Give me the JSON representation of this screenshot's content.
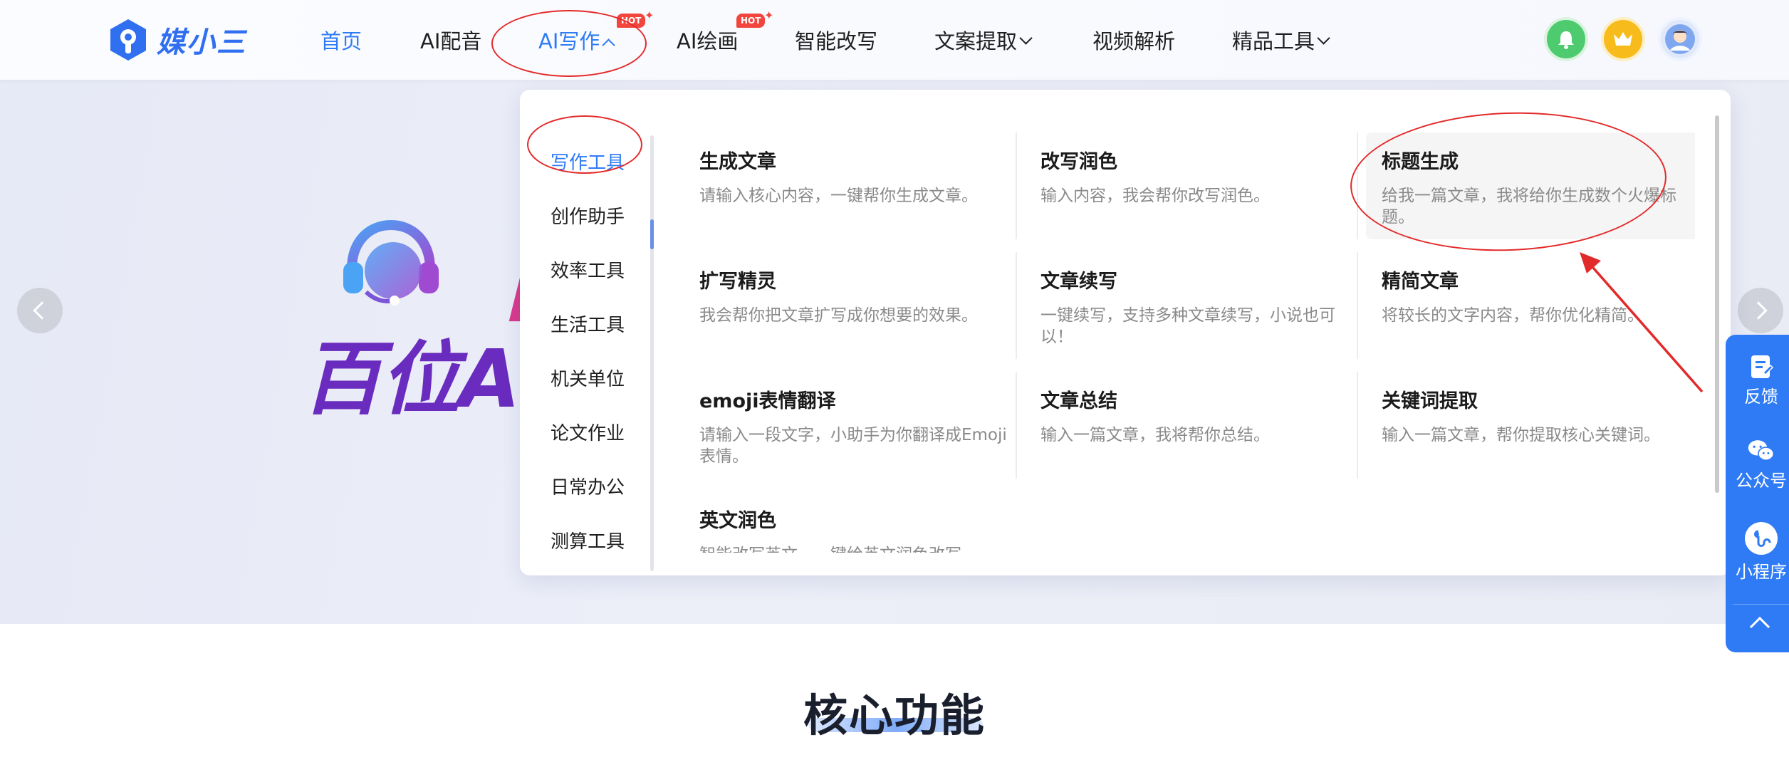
{
  "header": {
    "logo_text": "媒小三",
    "nav": [
      {
        "label": "首页",
        "active": true
      },
      {
        "label": "AI配音"
      },
      {
        "label": "AI写作",
        "open": true,
        "hot": true
      },
      {
        "label": "AI绘画",
        "hot": true
      },
      {
        "label": "智能改写"
      },
      {
        "label": "文案提取",
        "dropdown": true
      },
      {
        "label": "视频解析"
      },
      {
        "label": "精品工具",
        "dropdown": true
      }
    ],
    "hot_badge": "HOT",
    "icons": [
      "bell-icon",
      "crown-icon",
      "user-avatar"
    ]
  },
  "banner": {
    "bracket": "【",
    "text": "百位AI",
    "slides": 3,
    "active_slide": 2
  },
  "dropdown": {
    "categories": [
      "写作工具",
      "创作助手",
      "效率工具",
      "生活工具",
      "机关单位",
      "论文作业",
      "日常办公",
      "测算工具"
    ],
    "active_category": 0,
    "tools": [
      {
        "title": "生成文章",
        "desc": "请输入核心内容，一键帮你生成文章。"
      },
      {
        "title": "改写润色",
        "desc": "输入内容，我会帮你改写润色。"
      },
      {
        "title": "标题生成",
        "desc": "给我一篇文章，我将给你生成数个火爆标题。"
      },
      {
        "title": "扩写精灵",
        "desc": "我会帮你把文章扩写成你想要的效果。"
      },
      {
        "title": "文章续写",
        "desc": "一键续写，支持多种文章续写，小说也可以！"
      },
      {
        "title": "精简文章",
        "desc": "将较长的文字内容，帮你优化精简。"
      },
      {
        "title": "emoji表情翻译",
        "desc": "请输入一段文字，小助手为你翻译成Emoji表情。"
      },
      {
        "title": "文章总结",
        "desc": "输入一篇文章，我将帮你总结。"
      },
      {
        "title": "关键词提取",
        "desc": "输入一篇文章，帮你提取核心关键词。"
      },
      {
        "title": "英文润色",
        "desc": "智能改写英文，一键给英文润色改写"
      }
    ]
  },
  "floatbar": {
    "items": [
      {
        "label": "反馈",
        "icon": "feedback-icon"
      },
      {
        "label": "公众号",
        "icon": "wechat-icon"
      },
      {
        "label": "小程序",
        "icon": "mini-program-icon"
      }
    ],
    "back_to_top": "chevron-up-icon"
  },
  "section": {
    "title": "核心功能"
  },
  "colors": {
    "primary": "#2f7bf5",
    "hot": "#f2453d",
    "annotation": "#e32a2a"
  }
}
